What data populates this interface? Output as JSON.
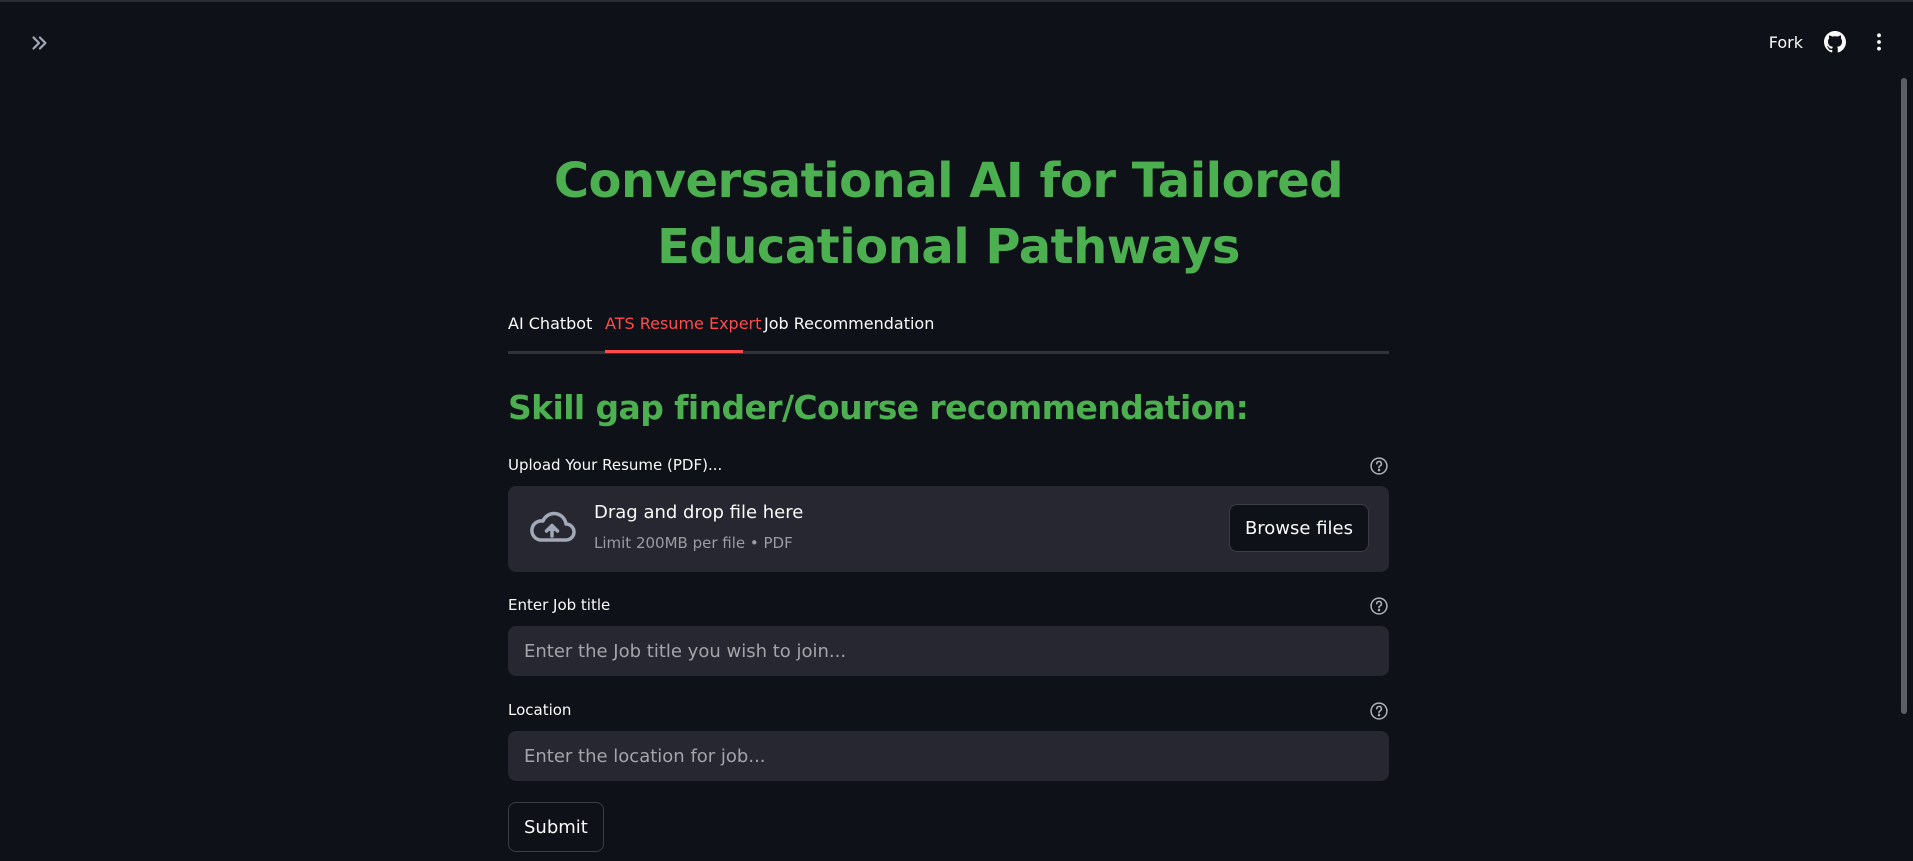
{
  "toolbar": {
    "expand_icon": "double-chevron-right-icon",
    "fork_label": "Fork",
    "github_icon": "github-icon",
    "menu_icon": "vertical-dots-icon"
  },
  "page": {
    "title_line1": "Conversational AI for Tailored",
    "title_line2": "Educational Pathways"
  },
  "tabs": [
    {
      "label": "AI Chatbot",
      "active": false
    },
    {
      "label": "ATS Resume Expert",
      "active": true
    },
    {
      "label": "Job Recommendation",
      "active": false
    }
  ],
  "section": {
    "heading": "Skill gap finder/Course recommendation:"
  },
  "uploader": {
    "label": "Upload Your Resume (PDF)...",
    "drop_text": "Drag and drop file here",
    "limit_text": "Limit 200MB per file • PDF",
    "browse_label": "Browse files",
    "icon": "cloud-upload-icon"
  },
  "job_title": {
    "label": "Enter Job title",
    "placeholder": "Enter the Job title you wish to join...",
    "value": ""
  },
  "location": {
    "label": "Location",
    "placeholder": "Enter the location for job...",
    "value": ""
  },
  "submit_label": "Submit",
  "colors": {
    "background": "#0e1117",
    "heading_green": "#4caf50",
    "accent_red": "#ff4b4b",
    "input_bg": "#262730"
  }
}
